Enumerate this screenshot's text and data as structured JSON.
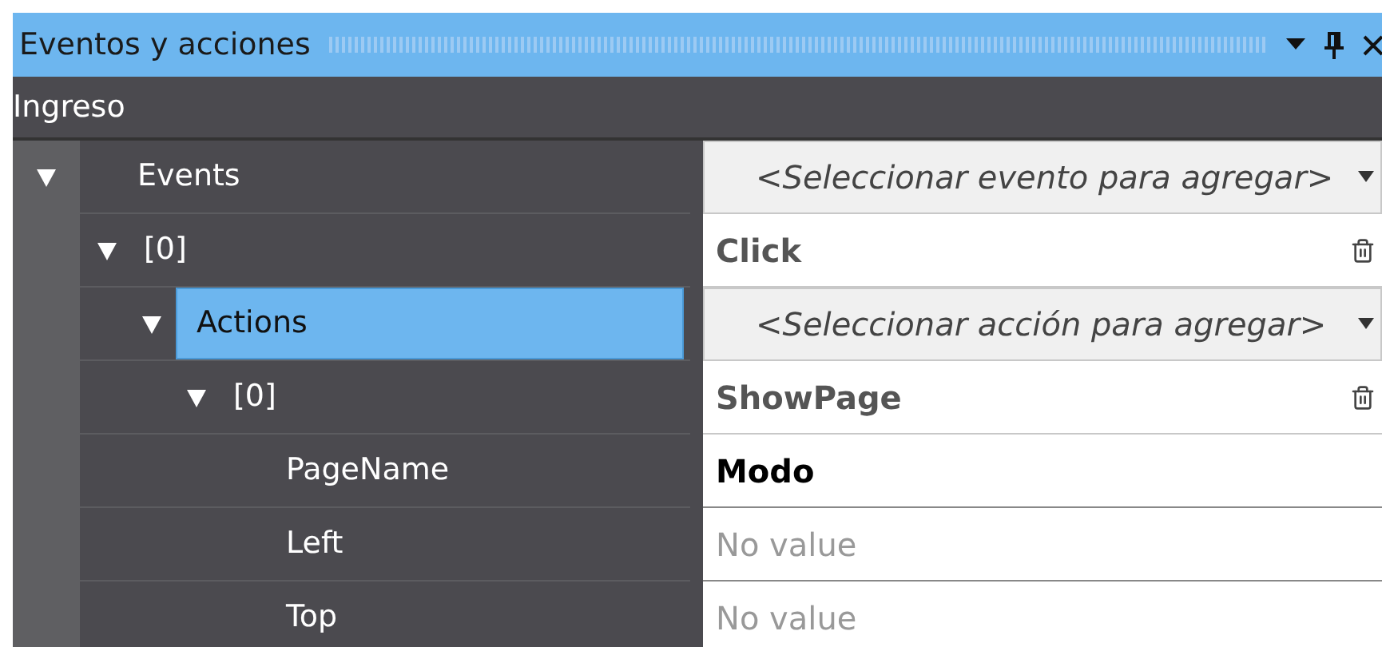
{
  "window": {
    "title": "Eventos y acciones"
  },
  "header": "Ingreso",
  "rows": [
    {
      "name": "Events",
      "expanded": true,
      "selected": false,
      "value": {
        "kind": "dropdown",
        "text": "<Seleccionar evento para agregar>"
      },
      "children": [
        {
          "name": "[0]",
          "expanded": true,
          "selected": false,
          "value": {
            "kind": "item",
            "text": "Click"
          },
          "children": [
            {
              "name": "Actions",
              "expanded": true,
              "selected": true,
              "value": {
                "kind": "dropdown",
                "text": "<Seleccionar acción para agregar>"
              },
              "children": [
                {
                  "name": "[0]",
                  "expanded": true,
                  "selected": false,
                  "value": {
                    "kind": "item",
                    "text": "ShowPage"
                  },
                  "children": [
                    {
                      "name": "PageName",
                      "selected": false,
                      "value": {
                        "kind": "set",
                        "text": "Modo"
                      }
                    },
                    {
                      "name": "Left",
                      "selected": false,
                      "value": {
                        "kind": "empty",
                        "text": "No value"
                      }
                    },
                    {
                      "name": "Top",
                      "selected": false,
                      "value": {
                        "kind": "empty",
                        "text": "No value"
                      }
                    }
                  ]
                }
              ]
            }
          ]
        }
      ]
    }
  ]
}
